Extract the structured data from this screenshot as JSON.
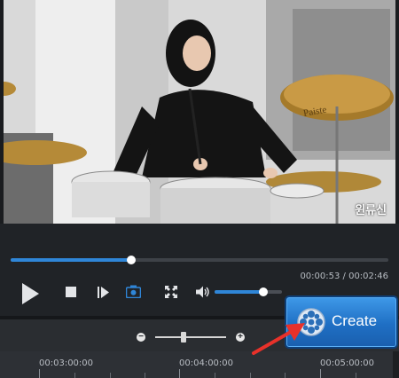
{
  "video": {
    "watermark": "윈류신"
  },
  "player": {
    "current_time": "00:00:53",
    "total_time": "00:02:46",
    "time_display": "00:00:53 / 00:02:46",
    "seek_progress": 0.32,
    "volume_level": 0.73,
    "accent_color": "#2f86d8"
  },
  "toolbar": {
    "play_icon": "play-icon",
    "stop_icon": "stop-icon",
    "next_frame_icon": "next-frame-icon",
    "snapshot_icon": "camera-icon",
    "fullscreen_icon": "fullscreen-icon",
    "volume_icon": "speaker-icon"
  },
  "timeline": {
    "zoom_minus": "−",
    "zoom_plus": "+",
    "zoom_level": 0.36,
    "ticks": [
      "00:03:00:00",
      "00:04:00:00",
      "00:05:00:00"
    ]
  },
  "create_button": {
    "label": "Create",
    "icon": "film-reel-icon",
    "color": "#2478cf"
  },
  "annotation": {
    "arrow_color": "#e8312a"
  }
}
